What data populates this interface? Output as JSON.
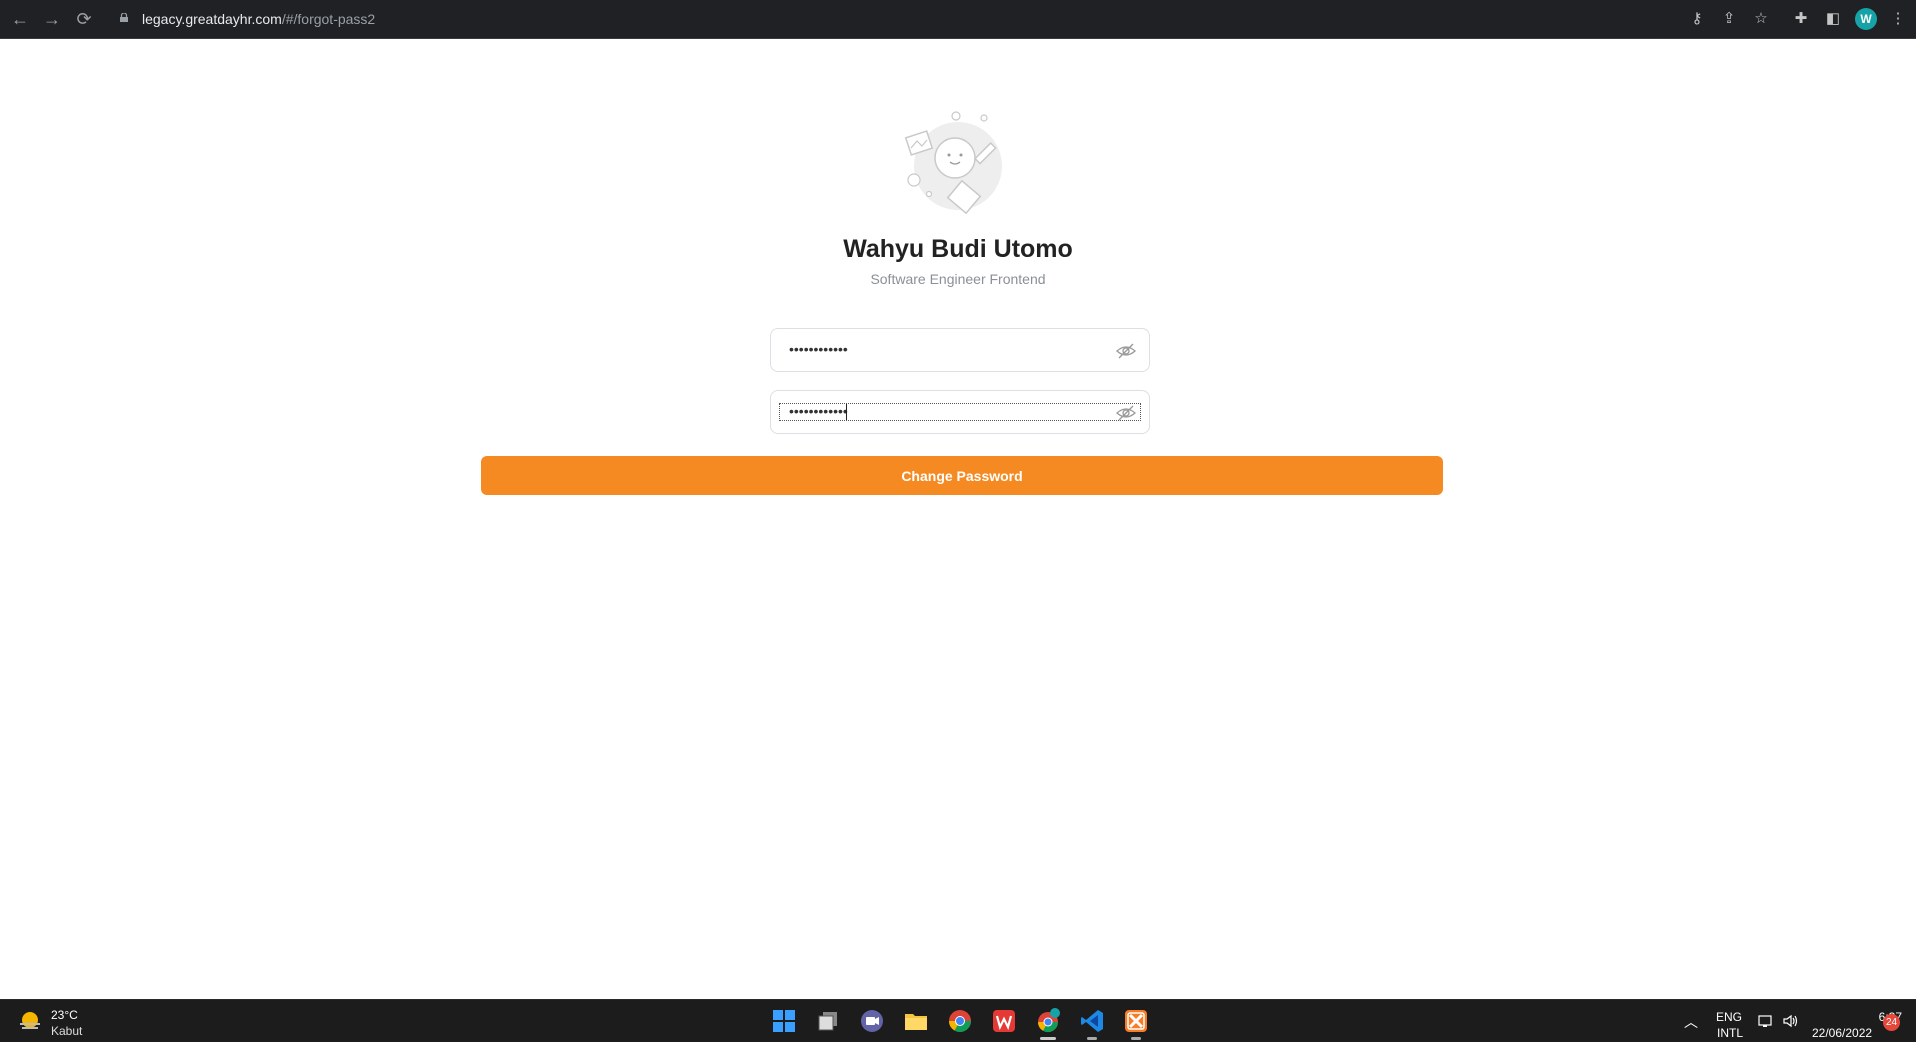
{
  "browser": {
    "url_host": "legacy.greatdayhr.com",
    "url_path": "/#/forgot-pass2",
    "profile_initial": "W"
  },
  "profile": {
    "name": "Wahyu Budi Utomo",
    "role": "Software Engineer Frontend"
  },
  "form": {
    "new_password_value": "••••••••••••",
    "confirm_password_value": "••••••••••••",
    "submit_label": "Change Password"
  },
  "taskbar": {
    "weather_temp": "23°C",
    "weather_desc": "Kabut",
    "lang_line1": "ENG",
    "lang_line2": "INTL",
    "time": "6:37",
    "date": "22/06/2022",
    "notification_count": "24"
  },
  "colors": {
    "accent": "#f58a22",
    "chrome_bg": "#202124",
    "taskbar_bg": "#1c1c1c"
  }
}
